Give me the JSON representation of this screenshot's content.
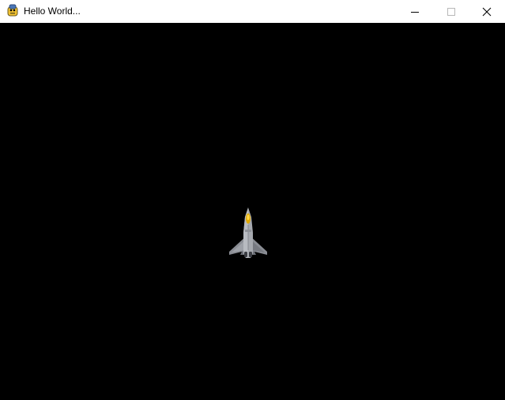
{
  "window": {
    "title": "Hello World..."
  },
  "game": {
    "background_color": "#000000",
    "sprites": [
      {
        "name": "player-jet",
        "icon": "fighter-jet-icon"
      }
    ]
  },
  "icons": {
    "app_icon": "pygame-snake-icon",
    "minimize": "minimize-icon",
    "maximize": "maximize-icon",
    "close": "close-icon"
  }
}
